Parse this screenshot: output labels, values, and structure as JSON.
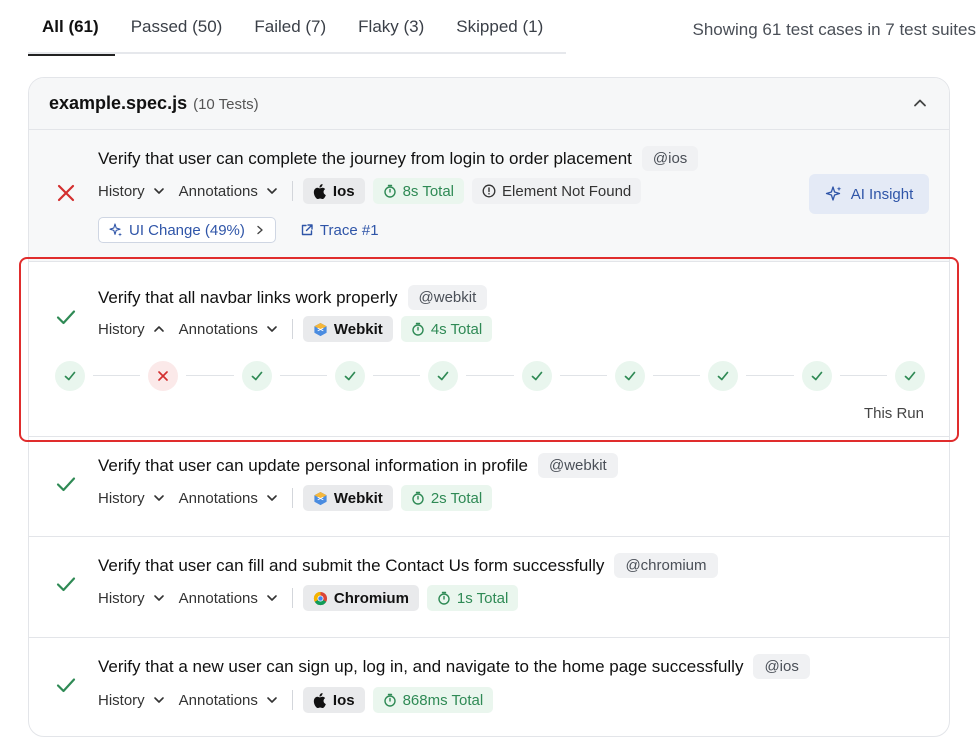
{
  "tabs": [
    {
      "label": "All (61)"
    },
    {
      "label": "Passed (50)"
    },
    {
      "label": "Failed (7)"
    },
    {
      "label": "Flaky (3)"
    },
    {
      "label": "Skipped (1)"
    }
  ],
  "summary": "Showing 61 test cases in 7 test suites",
  "suite": {
    "name": "example.spec.js",
    "count": "(10 Tests)"
  },
  "common": {
    "history": "History",
    "annotations": "Annotations"
  },
  "tests": [
    {
      "status": "failed",
      "title": "Verify that user can complete the journey from login to order placement",
      "tag": "@ios",
      "browser": "Ios",
      "time": "8s Total",
      "error": "Element Not Found",
      "ai_insight": "AI Insight",
      "ui_change": "UI Change (49%)",
      "trace": "Trace #1"
    },
    {
      "status": "passed",
      "title": "Verify that all navbar links work properly",
      "tag": "@webkit",
      "browser": "Webkit",
      "time": "4s Total",
      "history_expanded": true,
      "runs": [
        "passed",
        "failed",
        "passed",
        "passed",
        "passed",
        "passed",
        "passed",
        "passed",
        "passed",
        "passed"
      ],
      "this_run": "This Run"
    },
    {
      "status": "passed",
      "title": "Verify that user can update personal information in profile",
      "tag": "@webkit",
      "browser": "Webkit",
      "time": "2s Total"
    },
    {
      "status": "passed",
      "title": "Verify that user can fill and submit the Contact Us form successfully",
      "tag": "@chromium",
      "browser": "Chromium",
      "time": "1s Total"
    },
    {
      "status": "passed",
      "title": "Verify that a new user can sign up, log in, and navigate to the home page successfully",
      "tag": "@ios",
      "browser": "Ios",
      "time": "868ms Total"
    }
  ],
  "colors": {
    "pass": "#2f8a55",
    "fail": "#d32f2f",
    "accent": "#2f55a8",
    "highlight": "#e02d2d"
  }
}
